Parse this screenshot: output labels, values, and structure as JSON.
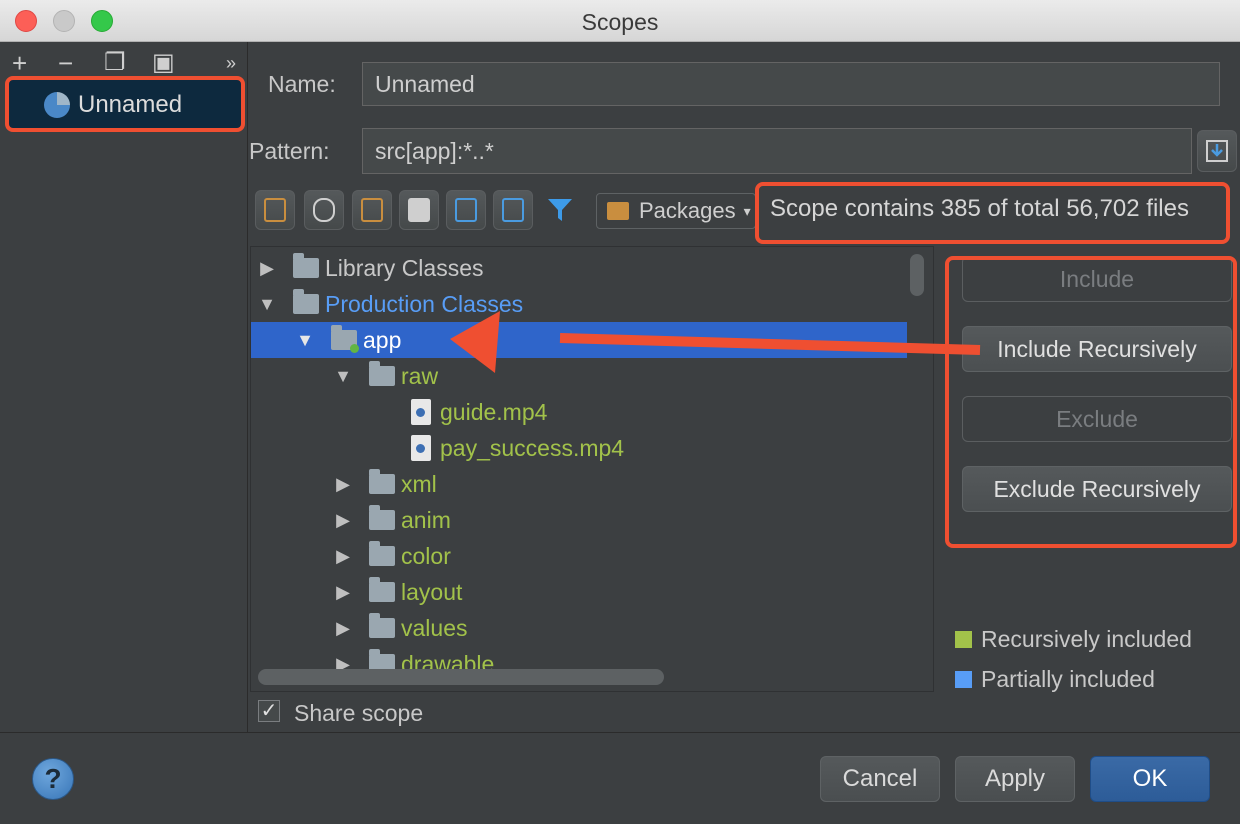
{
  "window": {
    "title": "Scopes"
  },
  "left_panel": {
    "toolbar": [
      {
        "name": "add-icon",
        "glyph": "+"
      },
      {
        "name": "remove-icon",
        "glyph": "−"
      },
      {
        "name": "copy-icon",
        "glyph": "❐"
      },
      {
        "name": "save-icon",
        "glyph": "▣"
      },
      {
        "name": "more-icon",
        "glyph": "»"
      }
    ],
    "scopes": [
      {
        "label": "Unnamed",
        "icon": "scope-pie-icon"
      }
    ]
  },
  "form": {
    "name_label": "Name:",
    "name_value": "Unnamed",
    "pattern_label": "Pattern:",
    "pattern_value": "src[app]:*..*"
  },
  "tree_toolbar": {
    "view_selector": "Packages",
    "scope_count_text": "Scope contains 385 of total 56,702 files"
  },
  "tree": {
    "items": [
      {
        "label": "Library Classes",
        "arrow": "▶",
        "color": "#c8c8c8"
      },
      {
        "label": "Production Classes",
        "arrow": "▼",
        "color": "#589df6"
      },
      {
        "label": "app",
        "arrow": "▼",
        "color": "#ffffff",
        "selected": true
      },
      {
        "label": "raw",
        "arrow": "▼",
        "color": "#a2c24a"
      },
      {
        "label": "guide.mp4",
        "arrow": "",
        "color": "#a2c24a",
        "file": true
      },
      {
        "label": "pay_success.mp4",
        "arrow": "",
        "color": "#a2c24a",
        "file": true
      },
      {
        "label": "xml",
        "arrow": "▶",
        "color": "#a2c24a"
      },
      {
        "label": "anim",
        "arrow": "▶",
        "color": "#a2c24a"
      },
      {
        "label": "color",
        "arrow": "▶",
        "color": "#a2c24a"
      },
      {
        "label": "layout",
        "arrow": "▶",
        "color": "#a2c24a"
      },
      {
        "label": "values",
        "arrow": "▶",
        "color": "#a2c24a"
      },
      {
        "label": "drawable",
        "arrow": "▶",
        "color": "#a2c24a"
      }
    ]
  },
  "actions": {
    "include": "Include",
    "include_recursively": "Include Recursively",
    "exclude": "Exclude",
    "exclude_recursively": "Exclude Recursively"
  },
  "legend": {
    "recursively_included": "Recursively included",
    "recursively_included_color": "#a2c24a",
    "partially_included": "Partially included",
    "partially_included_color": "#589df6"
  },
  "share_scope": {
    "label": "Share scope",
    "checked": true
  },
  "buttons": {
    "help": "?",
    "cancel": "Cancel",
    "apply": "Apply",
    "ok": "OK"
  },
  "colors": {
    "annotation": "#ef4f31",
    "selection": "#2f65ca"
  }
}
